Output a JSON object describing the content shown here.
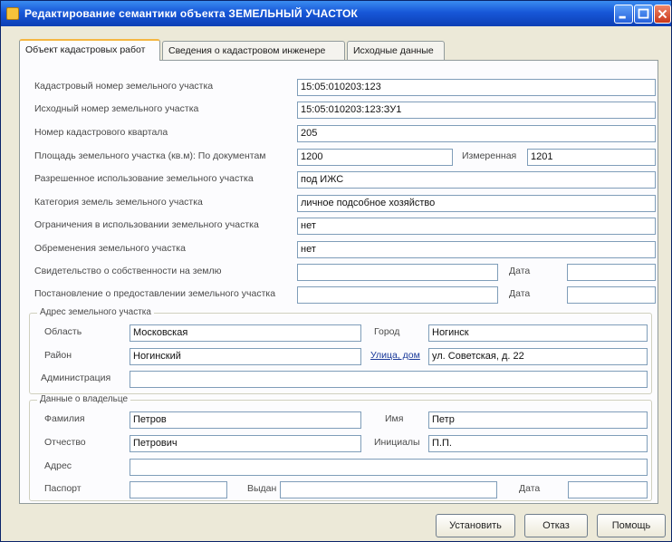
{
  "window": {
    "title": "Редактирование семантики объекта ЗЕМЕЛЬНЫЙ УЧАСТОК",
    "accent_color": "#1757d8"
  },
  "tabs": [
    {
      "label": "Объект кадастровых работ"
    },
    {
      "label": "Сведения о кадастровом инженере"
    },
    {
      "label": "Исходные данные"
    }
  ],
  "form": {
    "rows": [
      {
        "label": "Кадастровый номер земельного участка",
        "value": "15:05:010203:123"
      },
      {
        "label": "Исходный номер земельного участка",
        "value": "15:05:010203:123:ЗУ1"
      },
      {
        "label": "Номер кадастрового квартала",
        "value": "205"
      }
    ],
    "area": {
      "label": "Площадь земельного участка (кв.м): По документам",
      "value": "1200",
      "measured_label": "Измеренная",
      "measured_value": "1201"
    },
    "rows2": [
      {
        "label": "Разрешенное использование земельного участка",
        "value": "под ИЖС"
      },
      {
        "label": "Категория земель земельного участка",
        "value": "личное подсобное хозяйство"
      },
      {
        "label": "Ограничения в использовании земельного участка",
        "value": "нет"
      },
      {
        "label": "Обременения земельного участка",
        "value": "нет"
      }
    ],
    "docs": [
      {
        "label": "Свидетельство о собственности на землю",
        "value": "",
        "date_label": "Дата",
        "date_value": ""
      },
      {
        "label": "Постановление о предоставлении земельного участка",
        "value": "",
        "date_label": "Дата",
        "date_value": ""
      }
    ]
  },
  "address": {
    "title": "Адрес земельного участка",
    "region_label": "Область",
    "region_value": "Московская",
    "city_label": "Город",
    "city_value": "Ногинск",
    "district_label": "Район",
    "district_value": "Ногинский",
    "street_label": "Улица, дом",
    "street_value": "ул. Советская, д. 22",
    "admin_label": "Администрация",
    "admin_value": ""
  },
  "owner": {
    "title": "Данные о владельце",
    "surname_label": "Фамилия",
    "surname_value": "Петров",
    "name_label": "Имя",
    "name_value": "Петр",
    "patronymic_label": "Отчество",
    "patronymic_value": "Петрович",
    "initials_label": "Инициалы",
    "initials_value": "П.П.",
    "address_label": "Адрес",
    "address_value": "",
    "passport_label": "Паспорт",
    "passport_value": "",
    "issued_label": "Выдан",
    "issued_value": "",
    "date_label": "Дата",
    "date_value": ""
  },
  "buttons": {
    "install": "Установить",
    "cancel": "Отказ",
    "help": "Помощь"
  }
}
